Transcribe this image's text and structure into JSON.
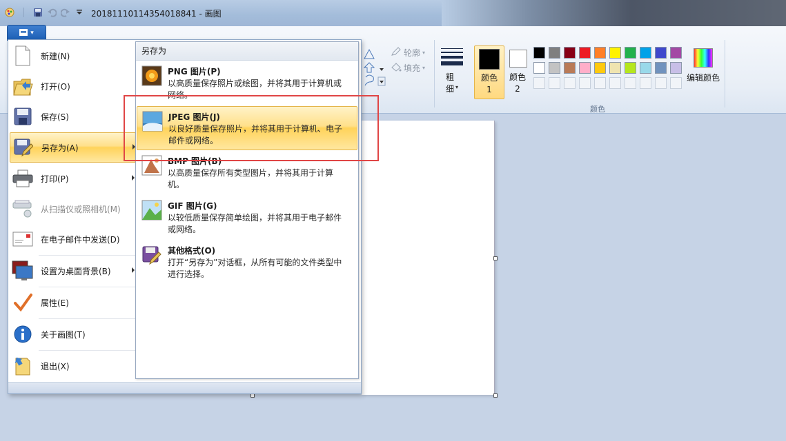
{
  "window": {
    "title": "20181110114354018841 - 画图"
  },
  "file_menu": {
    "items": [
      {
        "label": "新建(N)",
        "icon": "new-file-icon",
        "disabled": false,
        "submenu": false
      },
      {
        "label": "打开(O)",
        "icon": "open-folder-icon",
        "disabled": false,
        "submenu": false
      },
      {
        "label": "保存(S)",
        "icon": "save-disk-icon",
        "disabled": false,
        "submenu": false
      },
      {
        "label": "另存为(A)",
        "icon": "save-as-icon",
        "disabled": false,
        "submenu": true,
        "active": true
      },
      {
        "label": "打印(P)",
        "icon": "printer-icon",
        "disabled": false,
        "submenu": true
      },
      {
        "label": "从扫描仪或照相机(M)",
        "icon": "scanner-icon",
        "disabled": true,
        "submenu": false
      },
      {
        "label": "在电子邮件中发送(D)",
        "icon": "email-icon",
        "disabled": false,
        "submenu": false
      },
      {
        "label": "设置为桌面背景(B)",
        "icon": "desktop-icon",
        "disabled": false,
        "submenu": true
      },
      {
        "label": "属性(E)",
        "icon": "checkmark-icon",
        "disabled": false,
        "submenu": false
      },
      {
        "label": "关于画图(T)",
        "icon": "info-icon",
        "disabled": false,
        "submenu": false
      },
      {
        "label": "退出(X)",
        "icon": "exit-icon",
        "disabled": false,
        "submenu": false
      }
    ]
  },
  "save_as_menu": {
    "header": "另存为",
    "items": [
      {
        "title": "PNG 图片(P)",
        "desc": "以高质量保存照片或绘图，并将其用于计算机或网络。",
        "icon": "png-image-icon"
      },
      {
        "title": "JPEG 图片(J)",
        "desc": "以良好质量保存照片，并将其用于计算机、电子邮件或网络。",
        "icon": "jpeg-image-icon",
        "active": true
      },
      {
        "title": "BMP 图片(B)",
        "desc": "以高质量保存所有类型图片，并将其用于计算机。",
        "icon": "bmp-image-icon"
      },
      {
        "title": "GIF 图片(G)",
        "desc": "以较低质量保存简单绘图，并将其用于电子邮件或网络。",
        "icon": "gif-image-icon"
      },
      {
        "title": "其他格式(O)",
        "desc": "打开“另存为”对话框，从所有可能的文件类型中进行选择。",
        "icon": "other-format-icon"
      }
    ]
  },
  "ribbon": {
    "outline_label": "轮廓",
    "fill_label": "填充",
    "size_label": "粗细",
    "color1_label": "颜色 1",
    "color2_label": "颜色 2",
    "edit_colors_label": "编辑颜色",
    "colors_group_label": "颜色",
    "color1_value": "#000000",
    "color2_value": "#ffffff",
    "palette_row1": [
      "#000000",
      "#7f7f7f",
      "#880015",
      "#ed1c24",
      "#ff7f27",
      "#fff200",
      "#22b14c",
      "#00a2e8",
      "#3f48cc",
      "#a349a4"
    ],
    "palette_row2": [
      "#ffffff",
      "#c3c3c3",
      "#b97a57",
      "#ffaec9",
      "#ffc90e",
      "#efe4b0",
      "#b5e61d",
      "#99d9ea",
      "#7092be",
      "#c8bfe7"
    ]
  }
}
